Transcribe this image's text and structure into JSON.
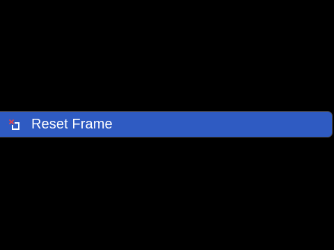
{
  "menu": {
    "items": [
      {
        "label": "Reset Frame",
        "icon": "reset-frame-icon",
        "highlighted": true
      }
    ]
  },
  "colors": {
    "background": "#000000",
    "highlight": "#2f5bc2",
    "border": "#46464c",
    "text": "#ffffff",
    "icon_x": "#d2455a",
    "icon_frame": "#ffffff"
  }
}
